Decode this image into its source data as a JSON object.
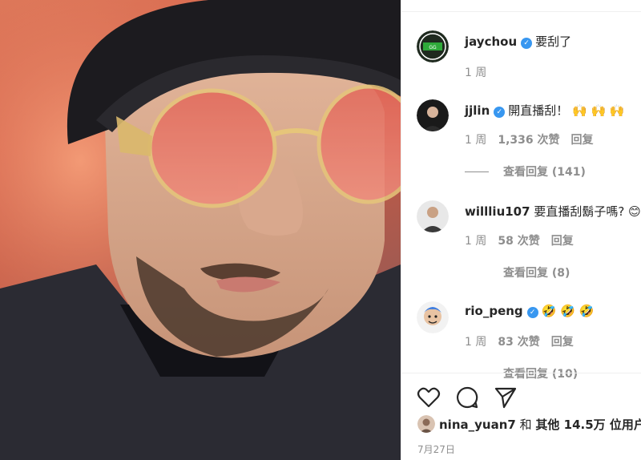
{
  "post": {
    "author": "jaychou",
    "caption": "要刮了",
    "time": "1 周"
  },
  "comments": [
    {
      "user": "jjlin",
      "verified": true,
      "text": "開直播刮！",
      "emojis": "🙌 🙌 🙌",
      "time": "1 周",
      "likes": "1,336 次赞",
      "reply_label": "回复",
      "view_replies": "查看回复 (141)"
    },
    {
      "user": "willliu107",
      "verified": false,
      "text": "要直播刮鬍子嗎?",
      "emojis": "😊",
      "time": "1 周",
      "likes": "58 次赞",
      "reply_label": "回复",
      "view_replies": "查看回复 (8)"
    },
    {
      "user": "rio_peng",
      "verified": true,
      "text": "",
      "emojis": "🤣 🤣 🤣",
      "time": "1 周",
      "likes": "83 次赞",
      "reply_label": "回复",
      "view_replies": "查看回复 (10)"
    }
  ],
  "likes_summary": {
    "liker": "nina_yuan7",
    "conj": "和",
    "others": "其他 14.5万 位用户"
  },
  "date": "7月27日",
  "icons": {
    "like": "heart-icon",
    "comment": "comment-icon",
    "share": "share-icon",
    "verified": "verified-badge-icon"
  },
  "colors": {
    "verified": "#3897f0",
    "secondary_text": "#8e8e8e",
    "primary_text": "#262626"
  }
}
